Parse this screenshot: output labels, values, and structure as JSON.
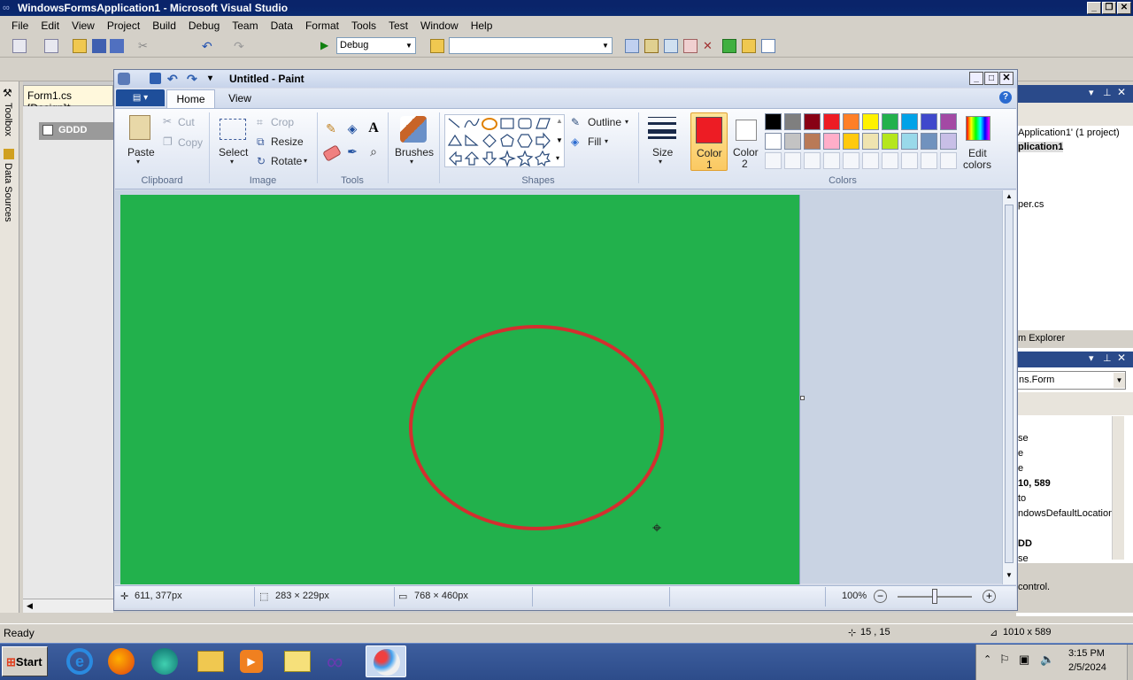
{
  "vs": {
    "title": "WindowsFormsApplication1 - Microsoft Visual Studio",
    "menu": [
      "File",
      "Edit",
      "View",
      "Project",
      "Build",
      "Debug",
      "Team",
      "Data",
      "Format",
      "Tools",
      "Test",
      "Window",
      "Help"
    ],
    "config_value": "Debug",
    "side_tabs": {
      "toolbox": "Toolbox",
      "data_sources": "Data Sources"
    },
    "doc_tab": "Form1.cs [Design]*",
    "form_caption": "GDDD",
    "solution_lines": [
      "Application1' (1 project)",
      "plication1",
      "per.cs"
    ],
    "solution_explorer_tab": "m Explorer",
    "props_combo": "ns.Form",
    "props_rows": [
      "se",
      "e",
      "e",
      "10, 589",
      "to",
      "ndowsDefaultLocation",
      "DD",
      "se"
    ],
    "props_desc": "control.",
    "status": {
      "text": "Ready",
      "pos": "15 , 15",
      "size": "1010 x 589"
    }
  },
  "paint": {
    "title": "Untitled - Paint",
    "tabs": {
      "home": "Home",
      "view": "View"
    },
    "clipboard": {
      "paste": "Paste",
      "cut": "Cut",
      "copy": "Copy",
      "label": "Clipboard"
    },
    "image": {
      "select": "Select",
      "crop": "Crop",
      "resize": "Resize",
      "rotate": "Rotate",
      "label": "Image"
    },
    "tools_label": "Tools",
    "brushes": "Brushes",
    "shapes": {
      "outline": "Outline",
      "fill": "Fill",
      "label": "Shapes"
    },
    "size": "Size",
    "color1": {
      "line1": "Color",
      "line2": "1"
    },
    "color2": {
      "line1": "Color",
      "line2": "2"
    },
    "colors_label": "Colors",
    "edit_colors": {
      "line1": "Edit",
      "line2": "colors"
    },
    "palette_row1": [
      "#000000",
      "#7f7f7f",
      "#880015",
      "#ed1c24",
      "#ff7f27",
      "#fff200",
      "#22b14c",
      "#00a2e8",
      "#3f48cc",
      "#a349a4"
    ],
    "palette_row2": [
      "#ffffff",
      "#c3c3c3",
      "#b97a57",
      "#ffaec9",
      "#ffc90e",
      "#efe4b0",
      "#b5e61d",
      "#99d9ea",
      "#7092be",
      "#c8bfe7"
    ],
    "canvas_color": "#22b14c",
    "ellipse_color": "#d32f2f",
    "status": {
      "cursor": "611, 377px",
      "selection": "283 × 229px",
      "size": "768 × 460px",
      "zoom": "100%"
    }
  },
  "taskbar": {
    "start": "Start",
    "time": "3:15 PM",
    "date": "2/5/2024"
  }
}
